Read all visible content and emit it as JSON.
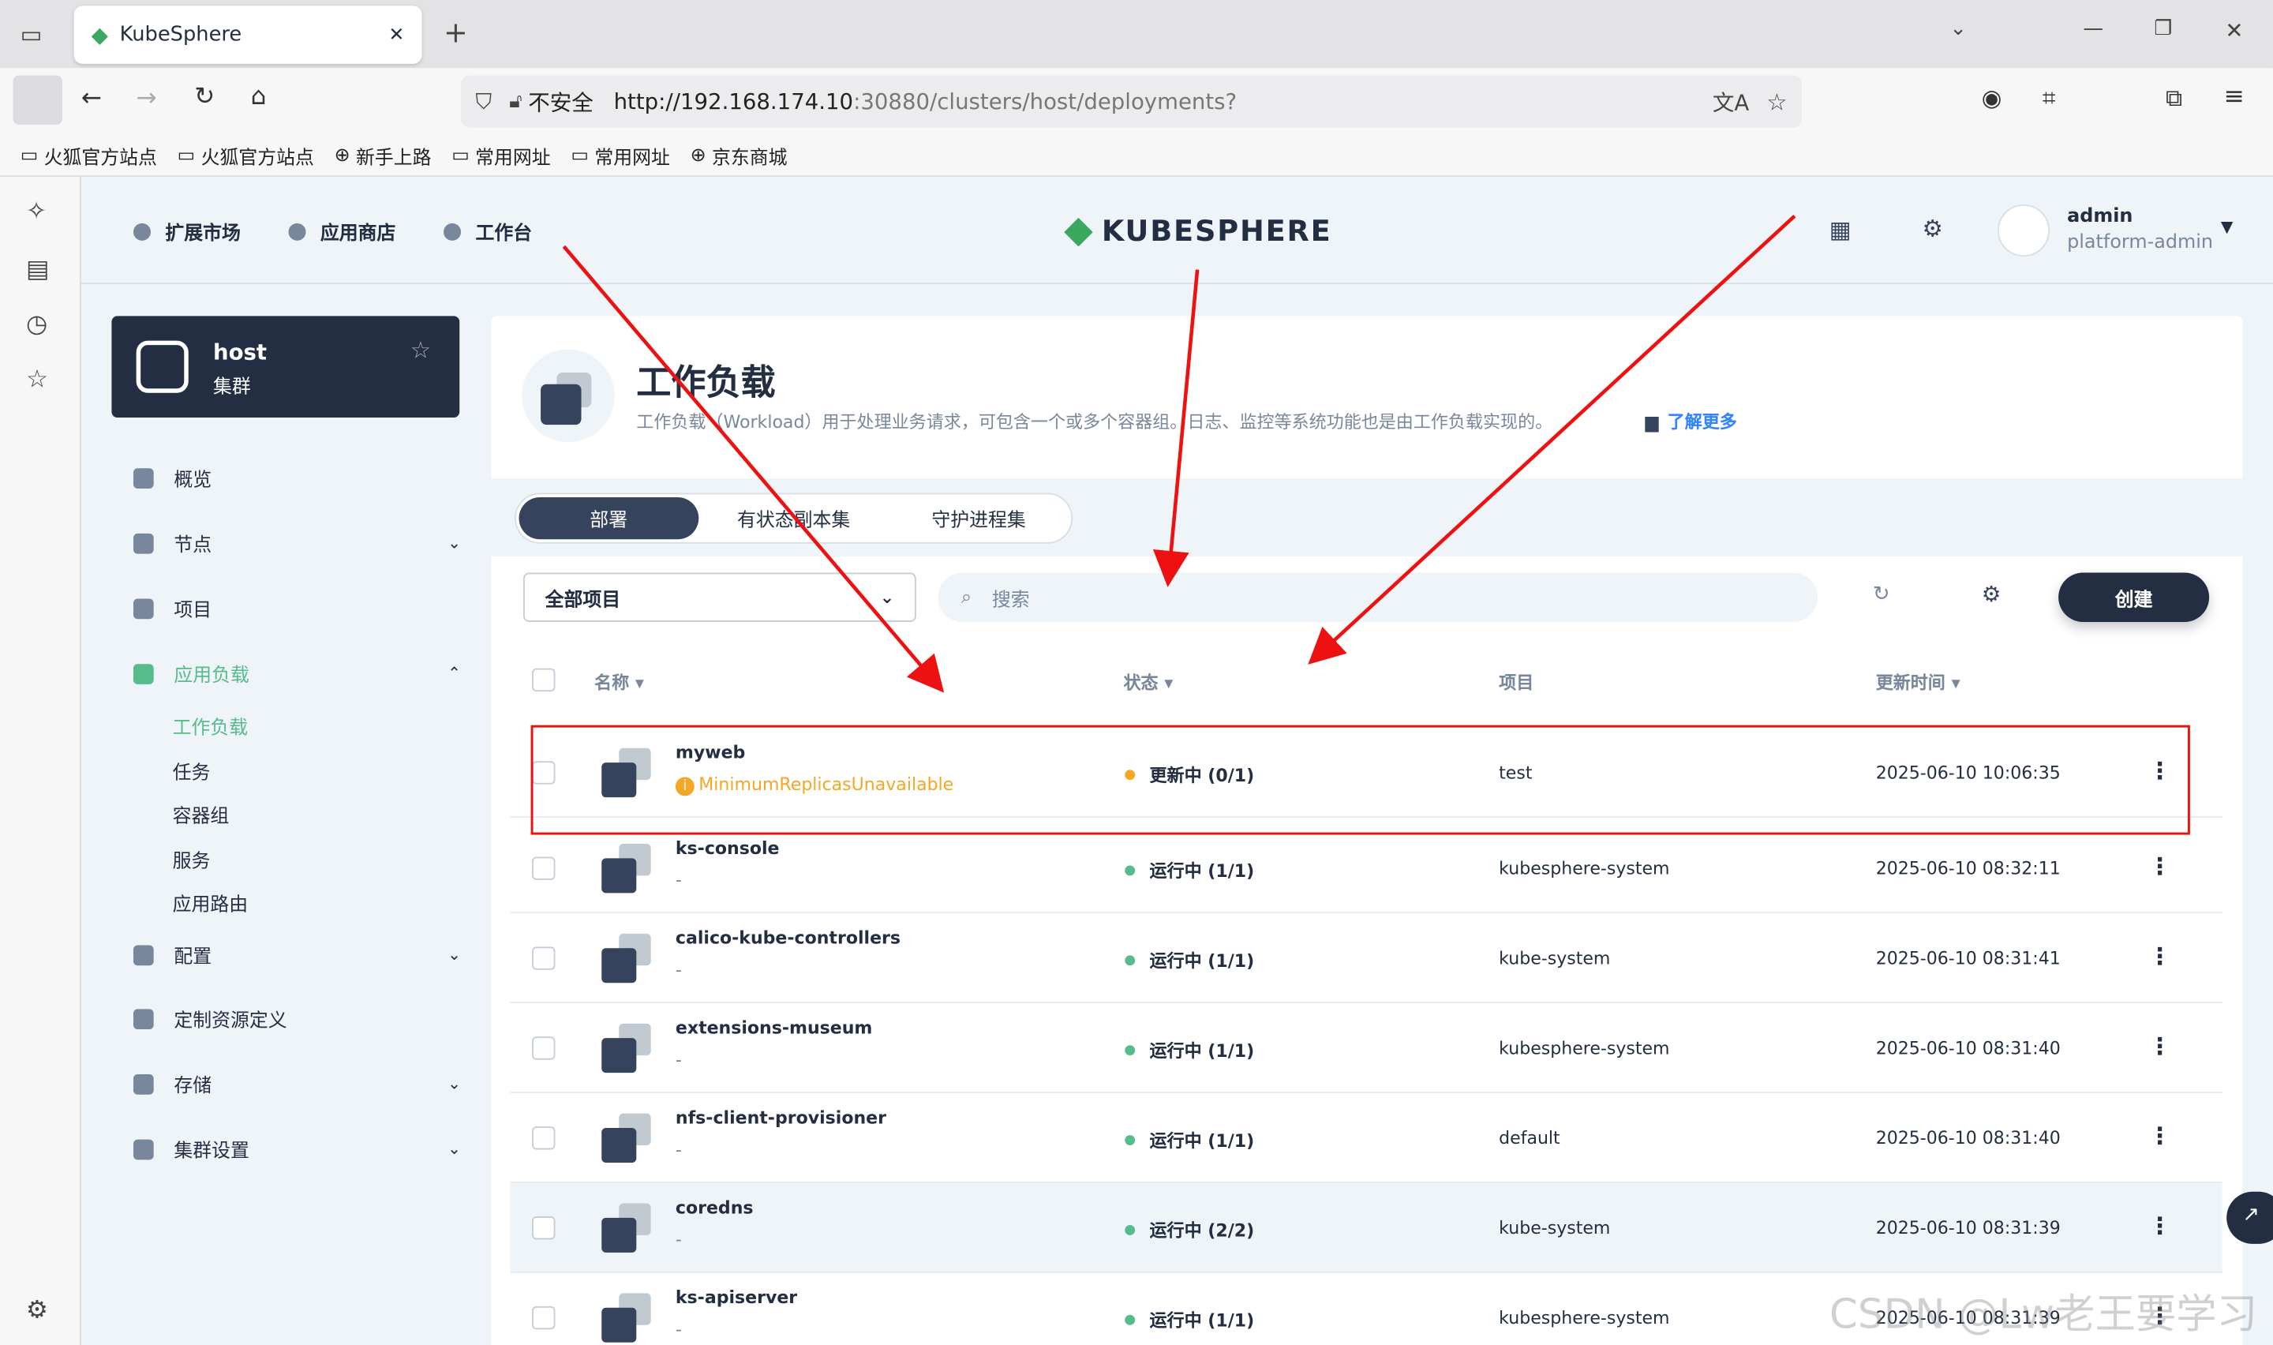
{
  "browser": {
    "tab_title": "KubeSphere",
    "tab_close": "✕",
    "new_tab": "+",
    "insecure_label": "不安全",
    "url_host": "http://192.168.174.10",
    "url_path": ":30880/clusters/host/deployments?",
    "bookmarks": [
      "火狐官方站点",
      "火狐官方站点",
      "新手上路",
      "常用网址",
      "常用网址",
      "京东商城"
    ]
  },
  "header": {
    "nav": [
      "扩展市场",
      "应用商店",
      "工作台"
    ],
    "logo_text": "KUBESPHERE",
    "user_name": "admin",
    "user_role": "platform-admin"
  },
  "cluster": {
    "name": "host",
    "type": "集群"
  },
  "sidebar": {
    "items": [
      "概览",
      "节点",
      "项目",
      "应用负载",
      "配置",
      "定制资源定义",
      "存储",
      "集群设置"
    ],
    "subitems": [
      "工作负载",
      "任务",
      "容器组",
      "服务",
      "应用路由"
    ]
  },
  "page": {
    "title": "工作负载",
    "description": "工作负载（Workload）用于处理业务请求，可包含一个或多个容器组。日志、监控等系统功能也是由工作负载实现的。",
    "learn_more": "了解更多",
    "tabs": [
      "部署",
      "有状态副本集",
      "守护进程集"
    ],
    "project_select": "全部项目",
    "search_placeholder": "搜索",
    "create_button": "创建"
  },
  "table": {
    "headers": [
      "名称",
      "状态",
      "项目",
      "更新时间"
    ],
    "rows": [
      {
        "name": "myweb",
        "sub": "MinimumReplicasUnavailable",
        "status": "更新中 (0/1)",
        "status_color": "#f5a623",
        "project": "test",
        "time": "2025-06-10 10:06:35"
      },
      {
        "name": "ks-console",
        "sub": "-",
        "status": "运行中 (1/1)",
        "status_color": "#55bc8a",
        "project": "kubesphere-system",
        "time": "2025-06-10 08:32:11"
      },
      {
        "name": "calico-kube-controllers",
        "sub": "-",
        "status": "运行中 (1/1)",
        "status_color": "#55bc8a",
        "project": "kube-system",
        "time": "2025-06-10 08:31:41"
      },
      {
        "name": "extensions-museum",
        "sub": "-",
        "status": "运行中 (1/1)",
        "status_color": "#55bc8a",
        "project": "kubesphere-system",
        "time": "2025-06-10 08:31:40"
      },
      {
        "name": "nfs-client-provisioner",
        "sub": "-",
        "status": "运行中 (1/1)",
        "status_color": "#55bc8a",
        "project": "default",
        "time": "2025-06-10 08:31:40"
      },
      {
        "name": "coredns",
        "sub": "-",
        "status": "运行中 (2/2)",
        "status_color": "#55bc8a",
        "project": "kube-system",
        "time": "2025-06-10 08:31:39"
      },
      {
        "name": "ks-apiserver",
        "sub": "-",
        "status": "运行中 (1/1)",
        "status_color": "#55bc8a",
        "project": "kubesphere-system",
        "time": "2025-06-10 08:31:39"
      }
    ]
  },
  "watermark": "CSDN @Lw老王要学习"
}
